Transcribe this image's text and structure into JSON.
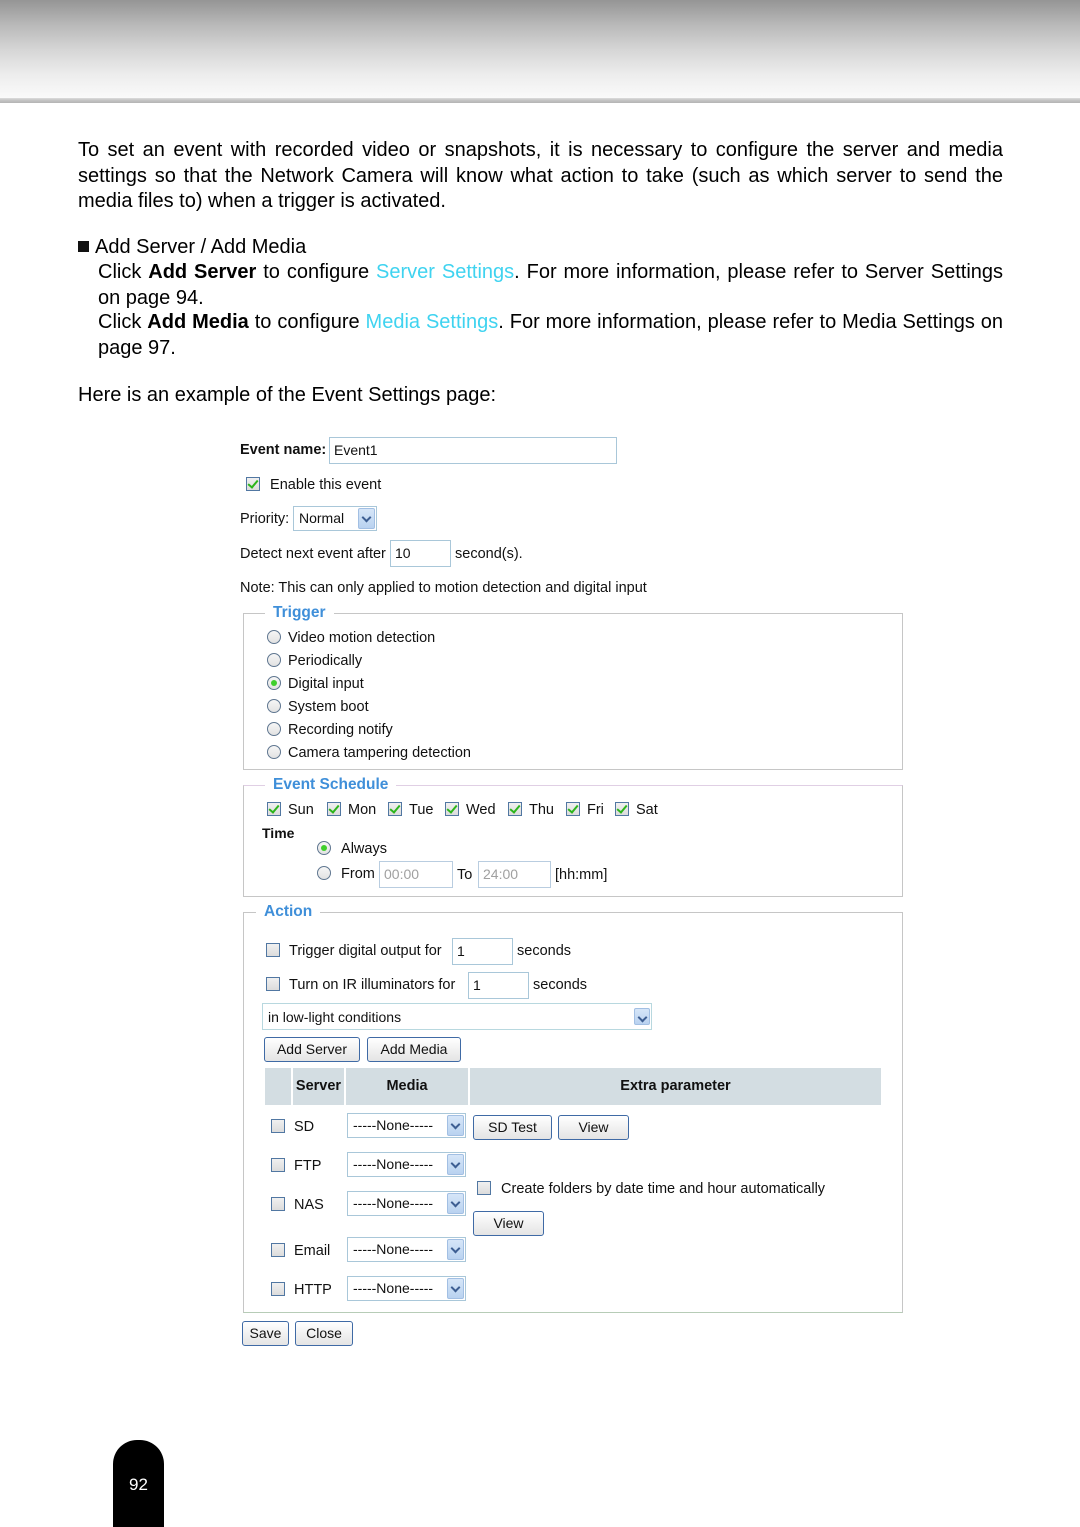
{
  "document": {
    "intro": "To set an event with recorded video or snapshots, it is necessary to configure the server and media settings so that the Network Camera will know what action to take (such as which server to send the media files to) when a trigger is activated.",
    "bullet_heading": "Add Server / Add Media",
    "add_server_para": {
      "prefix": "Click ",
      "bold": "Add Server",
      "middle": " to configure ",
      "link": "Server Settings",
      "suffix": ". For more information, please refer to Server Settings on page 94."
    },
    "add_media_para": {
      "prefix": "Click ",
      "bold": "Add Media",
      "middle": " to configure ",
      "link": "Media Settings",
      "suffix": ". For more information, please refer to Media Settings on page 97."
    },
    "example_caption": "Here is an example of the Event Settings page:",
    "page_number": "92",
    "link_color": "#3fd3f0"
  },
  "form": {
    "event_name_label": "Event name:",
    "event_name_value": "Event1",
    "enable_label": "Enable this event",
    "enable_checked": true,
    "priority_label": "Priority:",
    "priority_value": "Normal",
    "detect_label": "Detect next event after",
    "detect_value": "10",
    "detect_unit": "second(s).",
    "note": "Note: This can only applied to motion detection and digital input",
    "trigger": {
      "legend": "Trigger",
      "options": [
        {
          "label": "Video motion detection",
          "selected": false
        },
        {
          "label": "Periodically",
          "selected": false
        },
        {
          "label": "Digital input",
          "selected": true
        },
        {
          "label": "System boot",
          "selected": false
        },
        {
          "label": "Recording notify",
          "selected": false
        },
        {
          "label": "Camera tampering detection",
          "selected": false
        }
      ]
    },
    "schedule": {
      "legend": "Event Schedule",
      "days": [
        {
          "label": "Sun",
          "checked": true
        },
        {
          "label": "Mon",
          "checked": true
        },
        {
          "label": "Tue",
          "checked": true
        },
        {
          "label": "Wed",
          "checked": true
        },
        {
          "label": "Thu",
          "checked": true
        },
        {
          "label": "Fri",
          "checked": true
        },
        {
          "label": "Sat",
          "checked": true
        }
      ],
      "time_label": "Time",
      "always_label": "Always",
      "always_selected": true,
      "from_label": "From",
      "from_value": "00:00",
      "to_label": "To",
      "to_value": "24:00",
      "format_hint": "[hh:mm]"
    },
    "action": {
      "legend": "Action",
      "trigger_do_label": "Trigger digital output for",
      "trigger_do_value": "1",
      "trigger_do_unit": "seconds",
      "ir_label": "Turn on IR illuminators for",
      "ir_value": "1",
      "ir_unit": "seconds",
      "ir_condition": "in low-light conditions",
      "add_server": "Add Server",
      "add_media": "Add Media",
      "table_headers": {
        "server": "Server",
        "media": "Media",
        "extra": "Extra parameter"
      },
      "rows": [
        {
          "server": "SD",
          "media": "-----None-----"
        },
        {
          "server": "FTP",
          "media": "-----None-----"
        },
        {
          "server": "NAS",
          "media": "-----None-----"
        },
        {
          "server": "Email",
          "media": "-----None-----"
        },
        {
          "server": "HTTP",
          "media": "-----None-----"
        }
      ],
      "sd_test": "SD Test",
      "view": "View",
      "create_folders_label": "Create folders by date time and hour automatically",
      "nas_view": "View"
    },
    "save": "Save",
    "close": "Close"
  }
}
